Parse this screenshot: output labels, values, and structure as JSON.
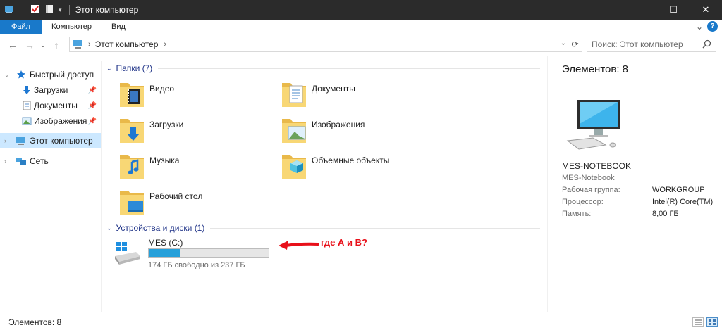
{
  "window": {
    "title": "Этот компьютер",
    "controls": {
      "minimize": "—",
      "maximize": "☐",
      "close": "✕"
    }
  },
  "ribbon": {
    "tabs": [
      "Файл",
      "Компьютер",
      "Вид"
    ],
    "help": "?",
    "expand": "⌄"
  },
  "nav": {
    "back": "←",
    "forward": "→",
    "recent": "⌄",
    "up": "↑",
    "address": "Этот компьютер",
    "search_placeholder": "Поиск: Этот компьютер"
  },
  "sidebar": {
    "items": [
      {
        "label": "Быстрый доступ",
        "icon": "star-icon"
      },
      {
        "label": "Загрузки",
        "icon": "download-icon",
        "pinned": true
      },
      {
        "label": "Документы",
        "icon": "documents-icon",
        "pinned": true
      },
      {
        "label": "Изображения",
        "icon": "pictures-icon",
        "pinned": true
      },
      {
        "label": "Этот компьютер",
        "icon": "computer-icon",
        "selected": true
      },
      {
        "label": "Сеть",
        "icon": "network-icon"
      }
    ]
  },
  "content": {
    "folders_header": "Папки (7)",
    "folders": [
      {
        "label": "Видео",
        "icon": "video-folder-icon"
      },
      {
        "label": "Документы",
        "icon": "documents-folder-icon"
      },
      {
        "label": "Загрузки",
        "icon": "downloads-folder-icon"
      },
      {
        "label": "Изображения",
        "icon": "pictures-folder-icon"
      },
      {
        "label": "Музыка",
        "icon": "music-folder-icon"
      },
      {
        "label": "Объемные объекты",
        "icon": "3d-objects-folder-icon"
      },
      {
        "label": "Рабочий стол",
        "icon": "desktop-folder-icon"
      }
    ],
    "drives_header": "Устройства и диски (1)",
    "drive": {
      "label": "MES (C:)",
      "free_text": "174 ГБ свободно из 237 ГБ",
      "used_fraction": 0.266,
      "icon": "windows-drive-icon"
    },
    "annotation": "где А и В?"
  },
  "details": {
    "count": "Элементов: 8",
    "computer_name": "MES-NOTEBOOK",
    "computer_sub": "MES-Notebook",
    "rows": [
      {
        "key": "Рабочая группа:",
        "value": "WORKGROUP"
      },
      {
        "key": "Процессор:",
        "value": "Intel(R) Core(TM)"
      },
      {
        "key": "Память:",
        "value": "8,00 ГБ"
      }
    ]
  },
  "status": {
    "text": "Элементов: 8"
  },
  "colors": {
    "accent": "#1979ca",
    "selection": "#cce8ff",
    "drive_fill": "#26a0da",
    "annotation": "#e8101a",
    "header_text": "#1e3287"
  }
}
